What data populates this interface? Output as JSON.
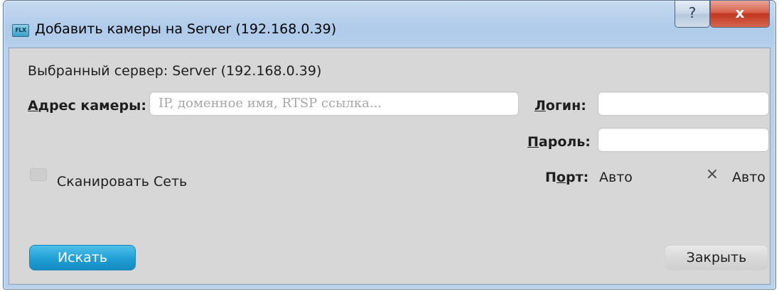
{
  "window": {
    "title": "Добавить камеры на Server (192.168.0.39)",
    "app_icon_text": "FLX",
    "help_glyph": "?",
    "close_glyph": "x"
  },
  "server_info": {
    "label": "Выбранный сервер:",
    "value": "Server (192.168.0.39)"
  },
  "camera_address": {
    "label_mnemonic": "А",
    "label_rest": "дрес камеры:",
    "placeholder": "IP, доменное имя, RTSP ссылка...",
    "value": ""
  },
  "login": {
    "label_mnemonic": "Л",
    "label_rest": "огин:",
    "value": ""
  },
  "password": {
    "label_mnemonic": "П",
    "label_rest": "ароль:",
    "value": ""
  },
  "scan_network": {
    "label": "Сканировать Сеть",
    "checked": false
  },
  "port": {
    "label_pre": "П",
    "label_mnemonic": "о",
    "label_rest": "рт:",
    "value": "Авто",
    "auto_label": "Авто",
    "auto_glyph": "×",
    "auto_checked": true
  },
  "buttons": {
    "search": "Искать",
    "close": "Закрыть"
  },
  "colors": {
    "accent": "#1f9fd6",
    "close_red": "#c2361f",
    "panel_bg": "#d7d7d7"
  }
}
